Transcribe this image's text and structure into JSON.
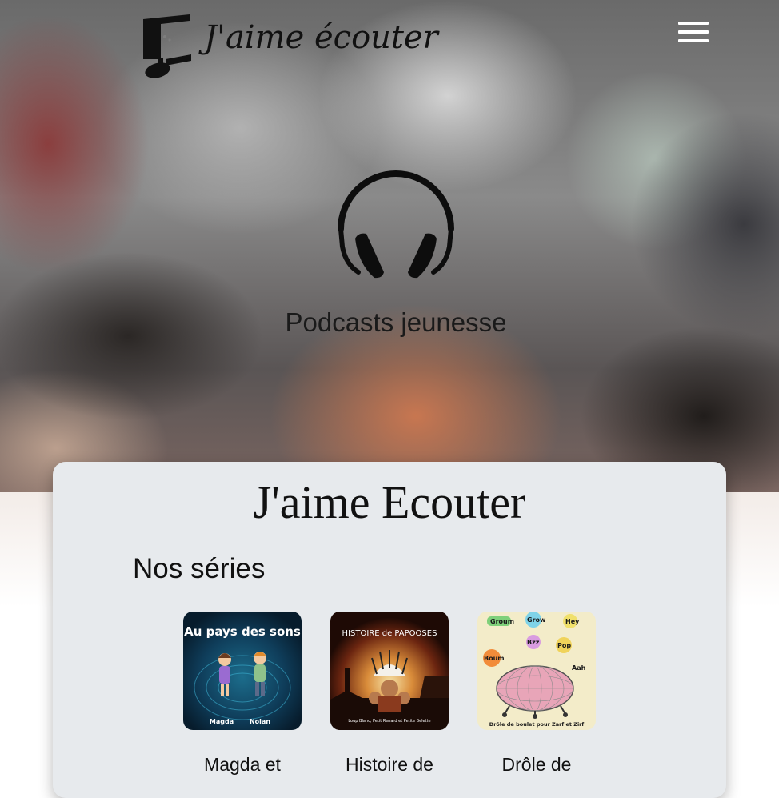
{
  "brand": {
    "logo_text": "J'aime écouter"
  },
  "header": {
    "menu_icon": "hamburger-menu-icon"
  },
  "hero": {
    "icon": "headphones-icon",
    "subtitle": "Podcasts jeunesse"
  },
  "card": {
    "title": "J'aime Ecouter",
    "section_title": "Nos séries",
    "series": [
      {
        "cover_title": "Au pays des sons",
        "cover_names": [
          "Magda",
          "Nolan"
        ],
        "name": "Magda et"
      },
      {
        "cover_title": "HISTOIRE de PAPOOSES",
        "cover_subtitle": "Loup Blanc, Petit Renard et Petite Belette",
        "name": "Histoire de"
      },
      {
        "cover_title": "Drôle de boulet pour Zarf et Zirf",
        "cover_words": [
          "Groum",
          "Grow",
          "Hey",
          "Boum",
          "Pop",
          "Aah",
          "Bzz"
        ],
        "name": "Drôle de"
      }
    ]
  },
  "colors": {
    "card_bg": "#e7eaed",
    "text": "#111111",
    "menu_icon": "#ffffff"
  }
}
